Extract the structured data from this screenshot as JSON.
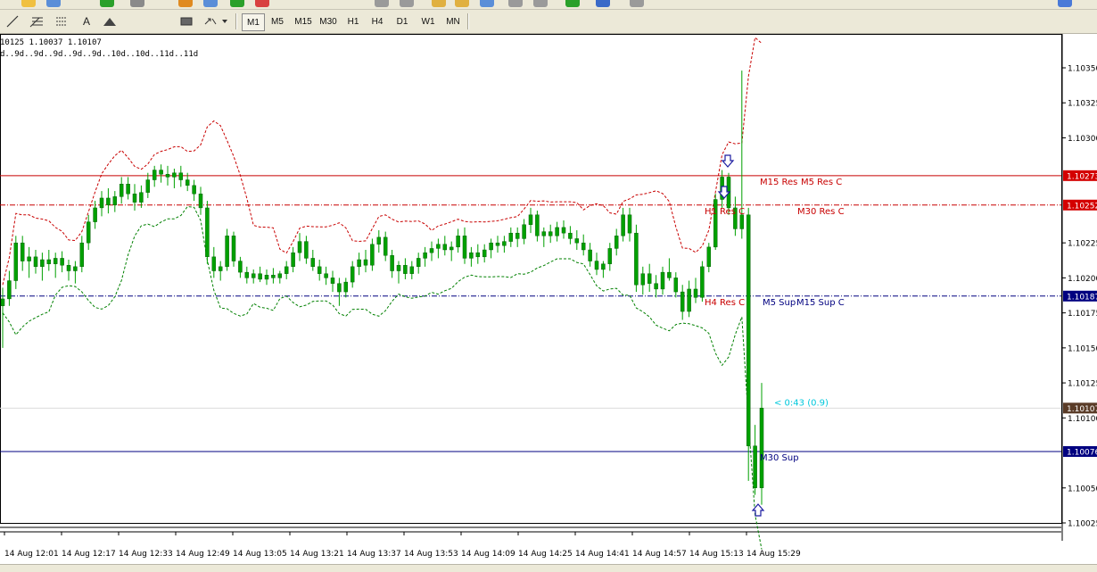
{
  "toolbar": {
    "drawing_tools": [
      "line-tool-icon",
      "fibonacci-tool-icon",
      "channel-tool-icon",
      "text-tool-icon",
      "arrow-up-tool-icon",
      "rectangle-tool-icon",
      "arrows-menu-icon"
    ],
    "text_tool_label": "A",
    "timeframes": [
      "M1",
      "M5",
      "M15",
      "M30",
      "H1",
      "H4",
      "D1",
      "W1",
      "MN"
    ]
  },
  "info": {
    "price_line": "10125 1.10037 1.10107",
    "days_line": "d..9d..9d..9d..9d..9d..10d..10d..11d..11d"
  },
  "chart_data": {
    "type": "candlestick",
    "x_tick_labels": [
      "14 Aug 12:01",
      "14 Aug 12:17",
      "14 Aug 12:33",
      "14 Aug 12:49",
      "14 Aug 13:05",
      "14 Aug 13:21",
      "14 Aug 13:37",
      "14 Aug 13:53",
      "14 Aug 14:09",
      "14 Aug 14:25",
      "14 Aug 14:41",
      "14 Aug 14:57",
      "14 Aug 15:13",
      "14 Aug 15:29"
    ],
    "y_tick_labels": [
      "1.10350",
      "1.10325",
      "1.10300",
      "1.10225",
      "1.10200",
      "1.10175",
      "1.10150",
      "1.10125",
      "1.10100",
      "1.10050",
      "1.10025"
    ],
    "ylim": [
      1.1001,
      1.1037
    ],
    "price_tags": [
      {
        "label": "1.10273",
        "value": 1.10273,
        "color": "#d40000"
      },
      {
        "label": "1.10252",
        "value": 1.10252,
        "color": "#d40000"
      },
      {
        "label": "1.10187",
        "value": 1.10187,
        "color": "#000080"
      },
      {
        "label": "1.10107",
        "value": 1.10107,
        "color": "#5a3c28"
      },
      {
        "label": "1.10076",
        "value": 1.10076,
        "color": "#000080"
      }
    ],
    "levels": [
      {
        "value": 1.10273,
        "color": "#c80000",
        "style": "solid"
      },
      {
        "value": 1.10252,
        "color": "#c80000",
        "style": "dashdot"
      },
      {
        "value": 1.10187,
        "color": "#000080",
        "style": "dashdot"
      },
      {
        "value": 1.10107,
        "color": "#dcdcdc",
        "style": "solid"
      },
      {
        "value": 1.10076,
        "color": "#000080",
        "style": "solid"
      }
    ],
    "level_labels": [
      {
        "text": "M15 Res",
        "value": 1.10273,
        "color": "#c80000"
      },
      {
        "text": "M5 Res C",
        "value": 1.10273,
        "color": "#c80000"
      },
      {
        "text": "H1 Res C",
        "value": 1.10252,
        "color": "#c80000"
      },
      {
        "text": "M30 Res C",
        "value": 1.10252,
        "color": "#c80000"
      },
      {
        "text": "H4 Res C",
        "value": 1.10187,
        "color": "#c80000"
      },
      {
        "text": "M5 Sup",
        "value": 1.10187,
        "color": "#000080"
      },
      {
        "text": "M15 Sup C",
        "value": 1.10187,
        "color": "#000080"
      },
      {
        "text": "M30 Sup",
        "value": 1.10076,
        "color": "#000080"
      }
    ],
    "timer_label": "< 0:43 (0.9)",
    "timer_color": "#00c8dc",
    "candle_color": "#00a000",
    "upper_band_color": "#c80000",
    "lower_band_color": "#008000",
    "grid": false,
    "candles": [
      [
        1.1018,
        1.10193,
        1.1015,
        1.10185
      ],
      [
        1.10185,
        1.10205,
        1.1018,
        1.10198
      ],
      [
        1.10198,
        1.1023,
        1.10192,
        1.10225
      ],
      [
        1.10225,
        1.1023,
        1.10205,
        1.10212
      ],
      [
        1.10212,
        1.10222,
        1.102,
        1.10215
      ],
      [
        1.10215,
        1.1022,
        1.10203,
        1.10208
      ],
      [
        1.10208,
        1.10218,
        1.10198,
        1.10213
      ],
      [
        1.10213,
        1.1022,
        1.10205,
        1.1021
      ],
      [
        1.1021,
        1.10218,
        1.102,
        1.10214
      ],
      [
        1.10214,
        1.10219,
        1.10204,
        1.10209
      ],
      [
        1.10209,
        1.10213,
        1.10198,
        1.10205
      ],
      [
        1.10205,
        1.10212,
        1.10196,
        1.10208
      ],
      [
        1.10208,
        1.1023,
        1.10204,
        1.10225
      ],
      [
        1.10225,
        1.10245,
        1.1022,
        1.1024
      ],
      [
        1.1024,
        1.10255,
        1.10235,
        1.1025
      ],
      [
        1.1025,
        1.10262,
        1.10244,
        1.10257
      ],
      [
        1.10257,
        1.10264,
        1.10246,
        1.10252
      ],
      [
        1.10252,
        1.10262,
        1.10247,
        1.10258
      ],
      [
        1.10258,
        1.10272,
        1.10253,
        1.10267
      ],
      [
        1.10267,
        1.10272,
        1.10256,
        1.1026
      ],
      [
        1.1026,
        1.10267,
        1.10248,
        1.10254
      ],
      [
        1.10254,
        1.10266,
        1.1025,
        1.10261
      ],
      [
        1.10261,
        1.10275,
        1.10257,
        1.1027
      ],
      [
        1.1027,
        1.1028,
        1.10265,
        1.10277
      ],
      [
        1.10277,
        1.10281,
        1.10268,
        1.10274
      ],
      [
        1.10274,
        1.1028,
        1.10266,
        1.10272
      ],
      [
        1.10272,
        1.10278,
        1.10264,
        1.10275
      ],
      [
        1.10275,
        1.1028,
        1.10265,
        1.1027
      ],
      [
        1.1027,
        1.10275,
        1.10262,
        1.10266
      ],
      [
        1.10266,
        1.1027,
        1.10255,
        1.1026
      ],
      [
        1.1026,
        1.10265,
        1.10245,
        1.1025
      ],
      [
        1.1025,
        1.10255,
        1.1021,
        1.10215
      ],
      [
        1.10215,
        1.10222,
        1.102,
        1.10205
      ],
      [
        1.10205,
        1.10212,
        1.10198,
        1.10208
      ],
      [
        1.10208,
        1.10235,
        1.10205,
        1.1023
      ],
      [
        1.1023,
        1.10233,
        1.10208,
        1.10212
      ],
      [
        1.10212,
        1.10215,
        1.102,
        1.10204
      ],
      [
        1.10204,
        1.10208,
        1.10196,
        1.102
      ],
      [
        1.102,
        1.10206,
        1.10196,
        1.10203
      ],
      [
        1.10203,
        1.10208,
        1.10197,
        1.10199
      ],
      [
        1.10199,
        1.10206,
        1.10195,
        1.10202
      ],
      [
        1.10202,
        1.10207,
        1.10196,
        1.102
      ],
      [
        1.102,
        1.10205,
        1.10196,
        1.10203
      ],
      [
        1.10203,
        1.10212,
        1.10199,
        1.10208
      ],
      [
        1.10208,
        1.10222,
        1.10204,
        1.10218
      ],
      [
        1.10218,
        1.10232,
        1.10212,
        1.10226
      ],
      [
        1.10226,
        1.1023,
        1.1021,
        1.10214
      ],
      [
        1.10214,
        1.1022,
        1.10205,
        1.10208
      ],
      [
        1.10208,
        1.10213,
        1.10198,
        1.10203
      ],
      [
        1.10203,
        1.10208,
        1.10195,
        1.102
      ],
      [
        1.102,
        1.10205,
        1.1019,
        1.10196
      ],
      [
        1.10196,
        1.102,
        1.1018,
        1.1019
      ],
      [
        1.1019,
        1.102,
        1.10186,
        1.10197
      ],
      [
        1.10197,
        1.10212,
        1.10193,
        1.10208
      ],
      [
        1.10208,
        1.10218,
        1.10202,
        1.10213
      ],
      [
        1.10213,
        1.1022,
        1.10204,
        1.10209
      ],
      [
        1.10209,
        1.10228,
        1.10205,
        1.10224
      ],
      [
        1.10224,
        1.10234,
        1.10218,
        1.10229
      ],
      [
        1.10229,
        1.10233,
        1.10212,
        1.10216
      ],
      [
        1.10216,
        1.1022,
        1.102,
        1.10205
      ],
      [
        1.10205,
        1.10212,
        1.10196,
        1.10209
      ],
      [
        1.10209,
        1.10214,
        1.10199,
        1.10203
      ],
      [
        1.10203,
        1.10212,
        1.10199,
        1.10208
      ],
      [
        1.10208,
        1.10218,
        1.10203,
        1.10214
      ],
      [
        1.10214,
        1.10222,
        1.10208,
        1.10218
      ],
      [
        1.10218,
        1.10226,
        1.10212,
        1.10221
      ],
      [
        1.10221,
        1.10228,
        1.10214,
        1.10224
      ],
      [
        1.10224,
        1.1023,
        1.10216,
        1.1022
      ],
      [
        1.1022,
        1.10226,
        1.10212,
        1.10222
      ],
      [
        1.10222,
        1.10235,
        1.10218,
        1.1023
      ],
      [
        1.1023,
        1.10236,
        1.1021,
        1.10214
      ],
      [
        1.10214,
        1.10222,
        1.10208,
        1.10218
      ],
      [
        1.10218,
        1.10224,
        1.1021,
        1.10215
      ],
      [
        1.10215,
        1.10224,
        1.10211,
        1.1022
      ],
      [
        1.1022,
        1.10228,
        1.10214,
        1.10225
      ],
      [
        1.10225,
        1.1023,
        1.10218,
        1.10223
      ],
      [
        1.10223,
        1.1023,
        1.10218,
        1.10226
      ],
      [
        1.10226,
        1.10236,
        1.10222,
        1.10232
      ],
      [
        1.10232,
        1.10236,
        1.10222,
        1.10228
      ],
      [
        1.10228,
        1.10242,
        1.10224,
        1.10238
      ],
      [
        1.10238,
        1.1025,
        1.10232,
        1.10245
      ],
      [
        1.10245,
        1.10248,
        1.10226,
        1.1023
      ],
      [
        1.1023,
        1.10236,
        1.10222,
        1.10233
      ],
      [
        1.10233,
        1.10238,
        1.10225,
        1.1023
      ],
      [
        1.1023,
        1.1024,
        1.10226,
        1.10236
      ],
      [
        1.10236,
        1.10241,
        1.10228,
        1.10232
      ],
      [
        1.10232,
        1.10237,
        1.10224,
        1.10228
      ],
      [
        1.10228,
        1.10234,
        1.1022,
        1.10225
      ],
      [
        1.10225,
        1.10231,
        1.10216,
        1.1022
      ],
      [
        1.1022,
        1.10225,
        1.10208,
        1.10212
      ],
      [
        1.10212,
        1.10218,
        1.10202,
        1.10206
      ],
      [
        1.10206,
        1.10212,
        1.102,
        1.1021
      ],
      [
        1.1021,
        1.10225,
        1.10205,
        1.10221
      ],
      [
        1.10221,
        1.10235,
        1.10216,
        1.1023
      ],
      [
        1.1023,
        1.1025,
        1.10226,
        1.10245
      ],
      [
        1.10245,
        1.1025,
        1.10226,
        1.10232
      ],
      [
        1.10232,
        1.10238,
        1.1019,
        1.10195
      ],
      [
        1.10195,
        1.10208,
        1.10188,
        1.10203
      ],
      [
        1.10203,
        1.1021,
        1.1019,
        1.10196
      ],
      [
        1.10196,
        1.10202,
        1.10186,
        1.10192
      ],
      [
        1.10192,
        1.10208,
        1.10188,
        1.10204
      ],
      [
        1.10204,
        1.10214,
        1.10198,
        1.102
      ],
      [
        1.102,
        1.10204,
        1.10186,
        1.1019
      ],
      [
        1.1019,
        1.10195,
        1.1017,
        1.10176
      ],
      [
        1.10176,
        1.10198,
        1.10172,
        1.10192
      ],
      [
        1.10192,
        1.102,
        1.10182,
        1.10186
      ],
      [
        1.10186,
        1.10212,
        1.10183,
        1.10208
      ],
      [
        1.10208,
        1.10225,
        1.10204,
        1.10222
      ],
      [
        1.10222,
        1.1026,
        1.1022,
        1.10256
      ],
      [
        1.10256,
        1.10277,
        1.1025,
        1.10272
      ],
      [
        1.10272,
        1.10275,
        1.10245,
        1.1025
      ],
      [
        1.1025,
        1.10258,
        1.1023,
        1.10235
      ],
      [
        1.10235,
        1.10348,
        1.10228,
        1.10245
      ],
      [
        1.10245,
        1.1025,
        1.10055,
        1.1008
      ],
      [
        1.1008,
        1.10095,
        1.10045,
        1.1005
      ],
      [
        1.1005,
        1.10125,
        1.10038,
        1.10107
      ]
    ]
  }
}
